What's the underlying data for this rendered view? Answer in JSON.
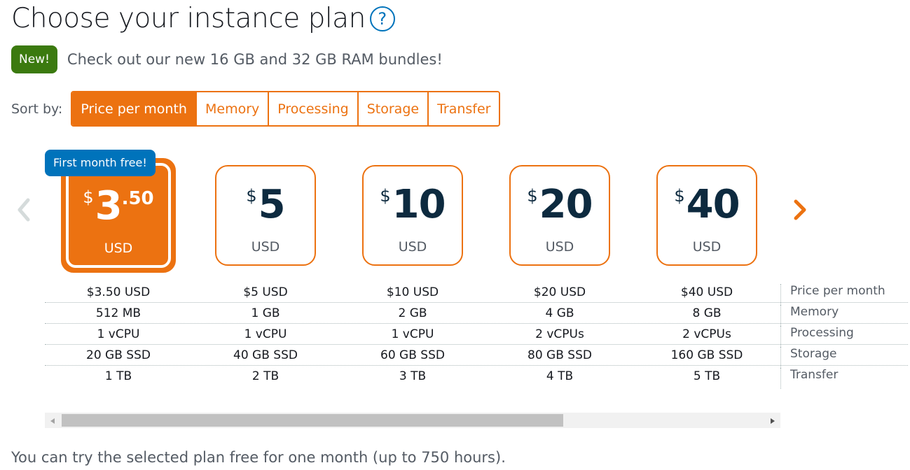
{
  "header": {
    "title": "Choose your instance plan",
    "help_icon": "?"
  },
  "promo": {
    "badge": "New!",
    "text": "Check out our new 16 GB and 32 GB RAM bundles!"
  },
  "sort": {
    "label": "Sort by:",
    "options": [
      "Price per month",
      "Memory",
      "Processing",
      "Storage",
      "Transfer"
    ],
    "selected": "Price per month"
  },
  "free_badge": "First month free!",
  "plans": [
    {
      "dollar": "$",
      "amount": "3",
      "cents": ".50",
      "currency": "USD",
      "selected": true,
      "price": "$3.50 USD",
      "memory": "512 MB",
      "processing": "1 vCPU",
      "storage": "20 GB SSD",
      "transfer": "1 TB"
    },
    {
      "dollar": "$",
      "amount": "5",
      "cents": "",
      "currency": "USD",
      "selected": false,
      "price": "$5 USD",
      "memory": "1 GB",
      "processing": "1 vCPU",
      "storage": "40 GB SSD",
      "transfer": "2 TB"
    },
    {
      "dollar": "$",
      "amount": "10",
      "cents": "",
      "currency": "USD",
      "selected": false,
      "price": "$10 USD",
      "memory": "2 GB",
      "processing": "1 vCPU",
      "storage": "60 GB SSD",
      "transfer": "3 TB"
    },
    {
      "dollar": "$",
      "amount": "20",
      "cents": "",
      "currency": "USD",
      "selected": false,
      "price": "$20 USD",
      "memory": "4 GB",
      "processing": "2 vCPUs",
      "storage": "80 GB SSD",
      "transfer": "4 TB"
    },
    {
      "dollar": "$",
      "amount": "40",
      "cents": "",
      "currency": "USD",
      "selected": false,
      "price": "$40 USD",
      "memory": "8 GB",
      "processing": "2 vCPUs",
      "storage": "160 GB SSD",
      "transfer": "5 TB"
    }
  ],
  "spec_labels": {
    "price": "Price per month",
    "memory": "Memory",
    "processing": "Processing",
    "storage": "Storage",
    "transfer": "Transfer"
  },
  "footer": "You can try the selected plan free for one month (up to 750 hours).",
  "colors": {
    "accent": "#ec7211",
    "badge_new": "#3b7a0f",
    "badge_free": "#0073bb",
    "price_text": "#0d2a3f"
  },
  "icons": {
    "prev": "chevron-left-icon",
    "next": "chevron-right-icon",
    "help": "question-circle-icon"
  }
}
